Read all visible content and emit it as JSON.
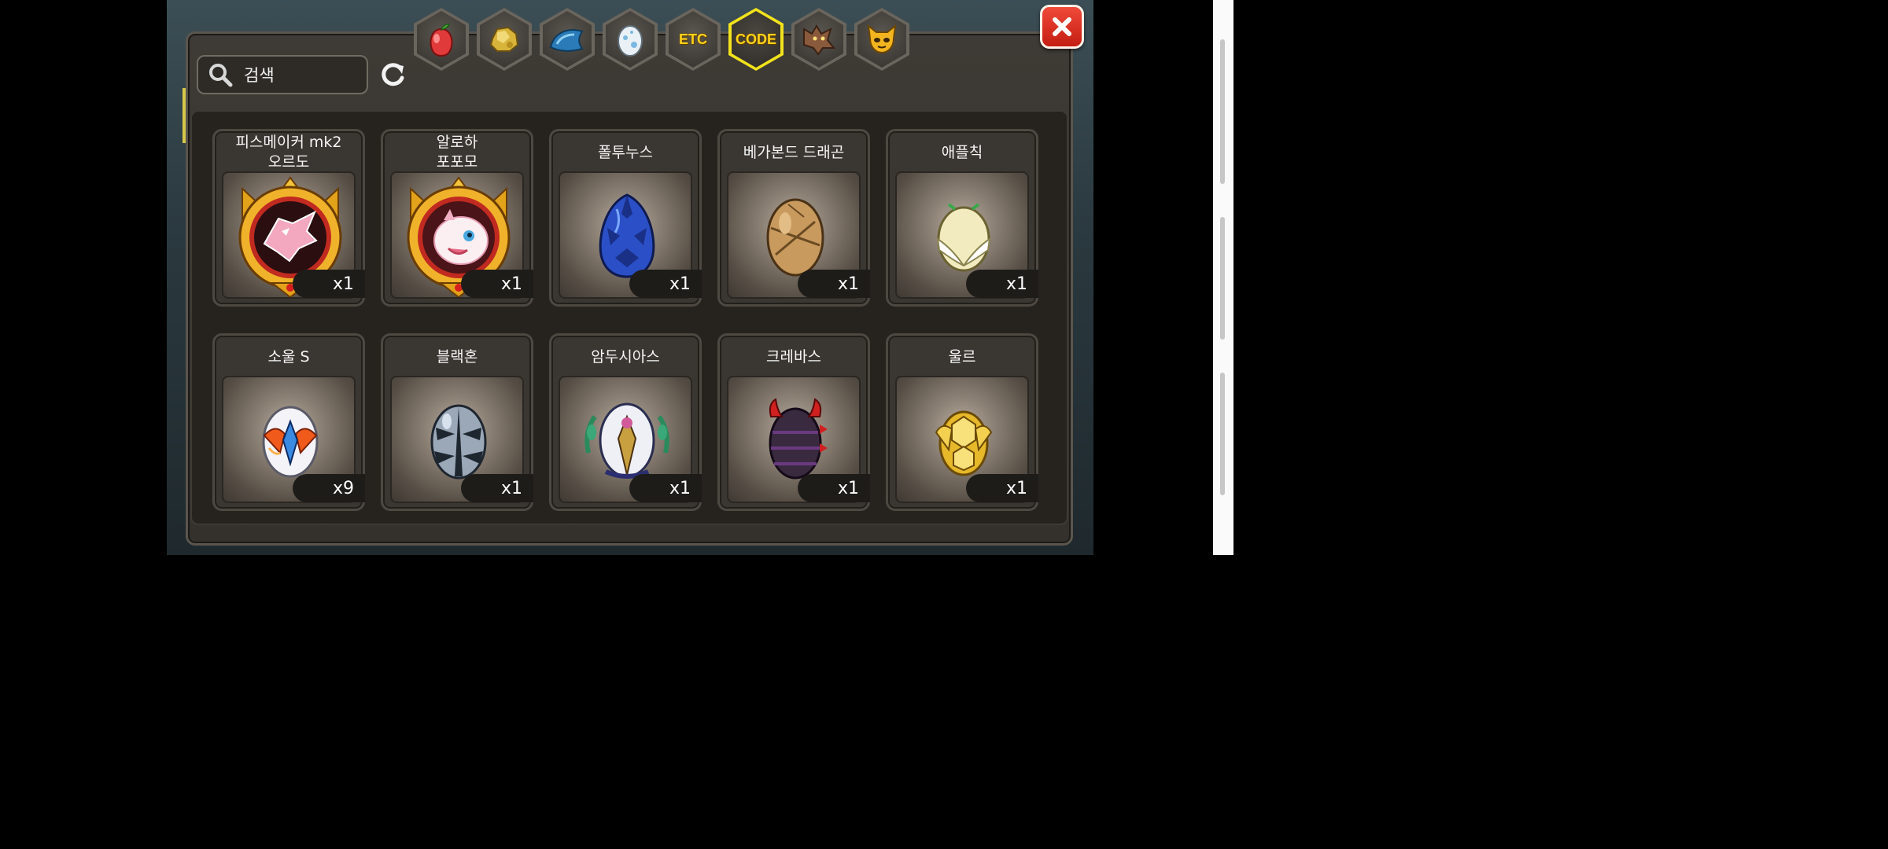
{
  "tabs": [
    {
      "id": "fruit",
      "icon": "red-fruit-icon",
      "text": "",
      "active": false
    },
    {
      "id": "gold",
      "icon": "gold-nugget-icon",
      "text": "",
      "active": false
    },
    {
      "id": "scale",
      "icon": "blue-scale-icon",
      "text": "",
      "active": false
    },
    {
      "id": "egg",
      "icon": "egg-icon",
      "text": "",
      "active": false
    },
    {
      "id": "etc",
      "icon": "",
      "text": "ETC",
      "active": false
    },
    {
      "id": "code",
      "icon": "",
      "text": "CODE",
      "active": true
    },
    {
      "id": "werewolf",
      "icon": "werewolf-icon",
      "text": "",
      "active": false
    },
    {
      "id": "spirit",
      "icon": "golden-spirit-icon",
      "text": "",
      "active": false
    }
  ],
  "search": {
    "placeholder": "검색"
  },
  "items": [
    {
      "name": "피스메이커 mk2\n오르도",
      "quantity": "x1",
      "icon": "crest-dragon-pink-icon"
    },
    {
      "name": "알로하\n포포모",
      "quantity": "x1",
      "icon": "crest-dragon-white-icon"
    },
    {
      "name": "폴투누스",
      "quantity": "x1",
      "icon": "blue-spiky-egg-icon"
    },
    {
      "name": "베가본드 드래곤",
      "quantity": "x1",
      "icon": "brown-bandaged-egg-icon"
    },
    {
      "name": "애플칙",
      "quantity": "x1",
      "icon": "winged-cream-egg-icon"
    },
    {
      "name": "소울 S",
      "quantity": "x9",
      "icon": "flame-crystal-egg-icon"
    },
    {
      "name": "블랙혼",
      "quantity": "x1",
      "icon": "silver-spiked-egg-icon"
    },
    {
      "name": "암두시아스",
      "quantity": "x1",
      "icon": "laurel-emblem-egg-icon"
    },
    {
      "name": "크레바스",
      "quantity": "x1",
      "icon": "dark-horned-egg-icon"
    },
    {
      "name": "울르",
      "quantity": "x1",
      "icon": "golden-armored-egg-icon"
    }
  ],
  "colors": {
    "active_tab": "#f2e21c",
    "close_button": "#d6281b",
    "tab_text": "#ffd21a"
  }
}
